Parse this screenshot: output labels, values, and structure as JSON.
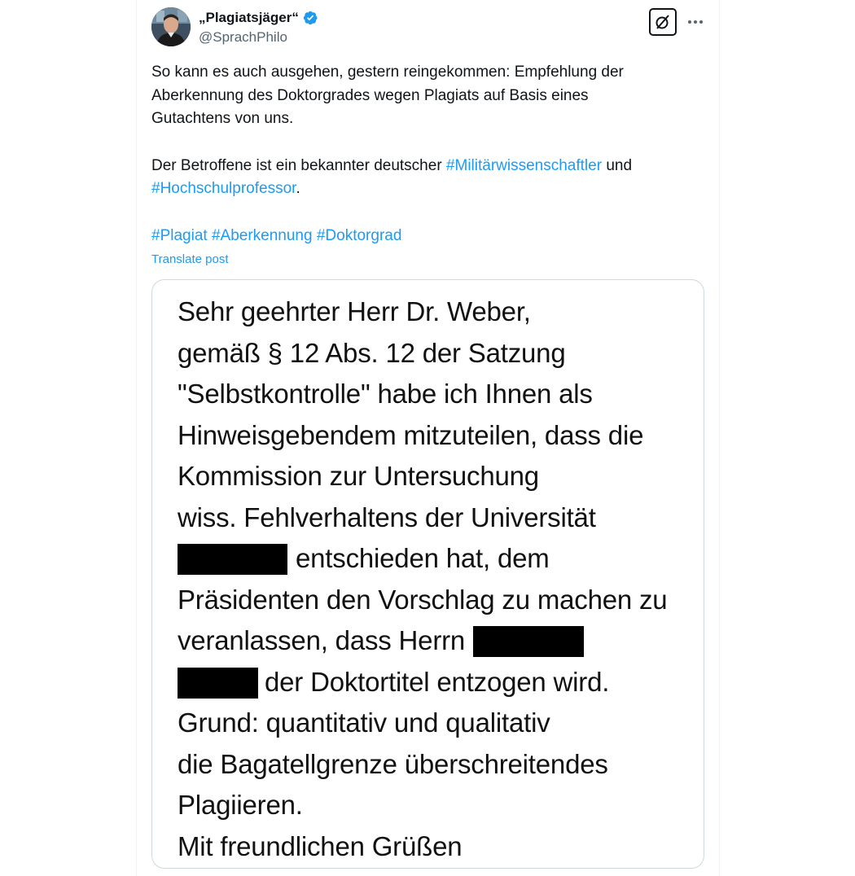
{
  "author": {
    "display_name": "„Plagiatsjäger“",
    "handle": "@SprachPhilo",
    "verified": true
  },
  "tweet": {
    "line1_a": "So kann es auch ausgehen, gestern reingekommen: Empfehlung der",
    "line1_b": "Aberkennung des Doktorgrades wegen Plagiats auf Basis eines",
    "line1_c": "Gutachtens von uns.",
    "line2_a": "Der Betroffene ist ein bekannter deutscher ",
    "hashtag_militaer": "#Militärwissenschaftler",
    "line2_b": " und",
    "hashtag_hochschul": "#Hochschulprofessor",
    "line2_c": ".",
    "hashtag_plagiat": "#Plagiat",
    "hashtag_aberkennung": "#Aberkennung",
    "hashtag_doktorgrad": "#Doktorgrad",
    "translate_label": "Translate post"
  },
  "letter": {
    "l1": "Sehr geehrter Herr Dr. Weber,",
    "l2": "gemäß § 12 Abs. 12 der Satzung",
    "l3": "\"Selbstkontrolle\" habe ich Ihnen als",
    "l4": "Hinweisgebendem mitzuteilen, dass die",
    "l5": "Kommission zur Untersuchung",
    "l6": "wiss. Fehlverhaltens der Universität",
    "l7": "entschieden hat, dem",
    "l8": "Präsidenten den Vorschlag zu machen zu",
    "l9": "veranlassen, dass Herrn",
    "l10": "der Doktortitel entzogen wird.",
    "l11": "Grund: quantitativ und qualitativ",
    "l12": "die Bagatellgrenze überschreitendes",
    "l13": "Plagiieren.",
    "l14": "Mit freundlichen Grüßen"
  },
  "icons": {
    "verified": "verified-badge-icon",
    "grok": "grok-icon",
    "more": "more-icon"
  },
  "colors": {
    "link": "#1d9bf0",
    "text": "#0f1419",
    "secondary": "#536471",
    "border": "#cfd9de"
  }
}
